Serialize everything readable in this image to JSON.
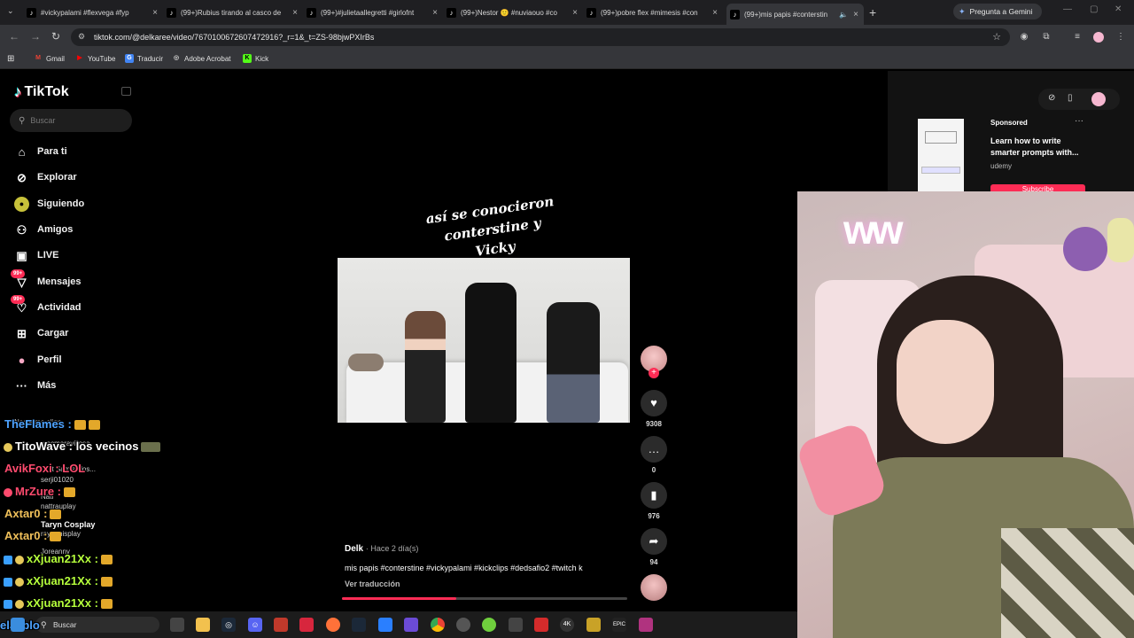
{
  "browser": {
    "tabs": [
      {
        "label": "#vickypalami #flexvega #fyp"
      },
      {
        "label": "(99+)Rubius tirando al casco de"
      },
      {
        "label": "(99+)#julietaallegretti #girlofnt"
      },
      {
        "label": "(99+)Nestor 🙂 #nuviaouo #co"
      },
      {
        "label": "(99+)pobre flex #mimesis #con"
      },
      {
        "label": "(99+)mis papis #conterstin"
      }
    ],
    "new_tab": "+",
    "gemini_label": "Pregunta a Gemini",
    "url": "tiktok.com/@delkaree/video/7670100672607472916?_r=1&_t=ZS-98bjwPXIrBs",
    "bookmarks": [
      {
        "label": "Gmail",
        "color": "#ea4335",
        "glyph": "M"
      },
      {
        "label": "YouTube",
        "color": "#ff0000",
        "glyph": "▶"
      },
      {
        "label": "Traducir",
        "color": "#4285f4",
        "glyph": "G"
      },
      {
        "label": "Adobe Acrobat",
        "color": "#cccccc",
        "glyph": "A"
      },
      {
        "label": "Kick",
        "color": "#53fc18",
        "glyph": "K"
      }
    ]
  },
  "sidebar": {
    "logo": "TikTok",
    "search_placeholder": "Buscar",
    "items": [
      {
        "label": "Para ti",
        "icon": "home-icon"
      },
      {
        "label": "Explorar",
        "icon": "compass-icon"
      },
      {
        "label": "Siguiendo",
        "icon": "following-icon"
      },
      {
        "label": "Amigos",
        "icon": "friends-icon"
      },
      {
        "label": "LIVE",
        "icon": "live-icon"
      },
      {
        "label": "Mensajes",
        "icon": "messages-icon",
        "badge": "99+"
      },
      {
        "label": "Actividad",
        "icon": "activity-icon",
        "badge": "99+"
      },
      {
        "label": "Cargar",
        "icon": "upload-icon"
      },
      {
        "label": "Perfil",
        "icon": "profile-icon"
      },
      {
        "label": "Más",
        "icon": "more-icon"
      }
    ]
  },
  "video": {
    "overlay_text": "así se conocieron conterstine y Vicky",
    "author": "Delk",
    "time": "· Hace 2 día(s)",
    "caption": "mis papis #conterstine #vickypalami #kickclips  #dedsafio2 #twitch k",
    "translate": "Ver traducción",
    "progress": 0.4,
    "likes": "9308",
    "comments": "0",
    "saves": "976",
    "shares": "94"
  },
  "ad": {
    "sponsored": "Sponsored",
    "title": "Learn how to write smarter prompts with...",
    "brand": "udemy",
    "cta": "Subscribe"
  },
  "chat": {
    "lines": [
      {
        "text": "TheFlames :",
        "color": "#4ea3ff"
      },
      {
        "text": "TitoWave : los vecinos",
        "color": "#ffffff"
      },
      {
        "text": "AvikFoxi : LOL",
        "color": "#ff4b6e"
      },
      {
        "text": "MrZure :",
        "color": "#ff4b6e"
      },
      {
        "text": "Axtar0 :",
        "color": "#f0c05a"
      },
      {
        "text": "Axtar0 :",
        "color": "#f0c05a"
      },
      {
        "text": "xXjuan21Xx :",
        "color": "#b6ff3c"
      },
      {
        "text": "xXjuan21Xx :",
        "color": "#b6ff3c"
      },
      {
        "text": "xXjuan21Xx :",
        "color": "#b6ff3c"
      },
      {
        "text": "elJablo",
        "color": "#4ea3ff"
      }
    ],
    "sub_lines": [
      "Nadie me elige",
      "macmaravillosa",
      "Just Sam's clos...",
      "serji01020",
      "Nati",
      "nattrauplay",
      "Taryn Cosplay",
      "raynanisplay",
      "Joreanny"
    ]
  },
  "taskbar": {
    "search_placeholder": "Buscar"
  }
}
